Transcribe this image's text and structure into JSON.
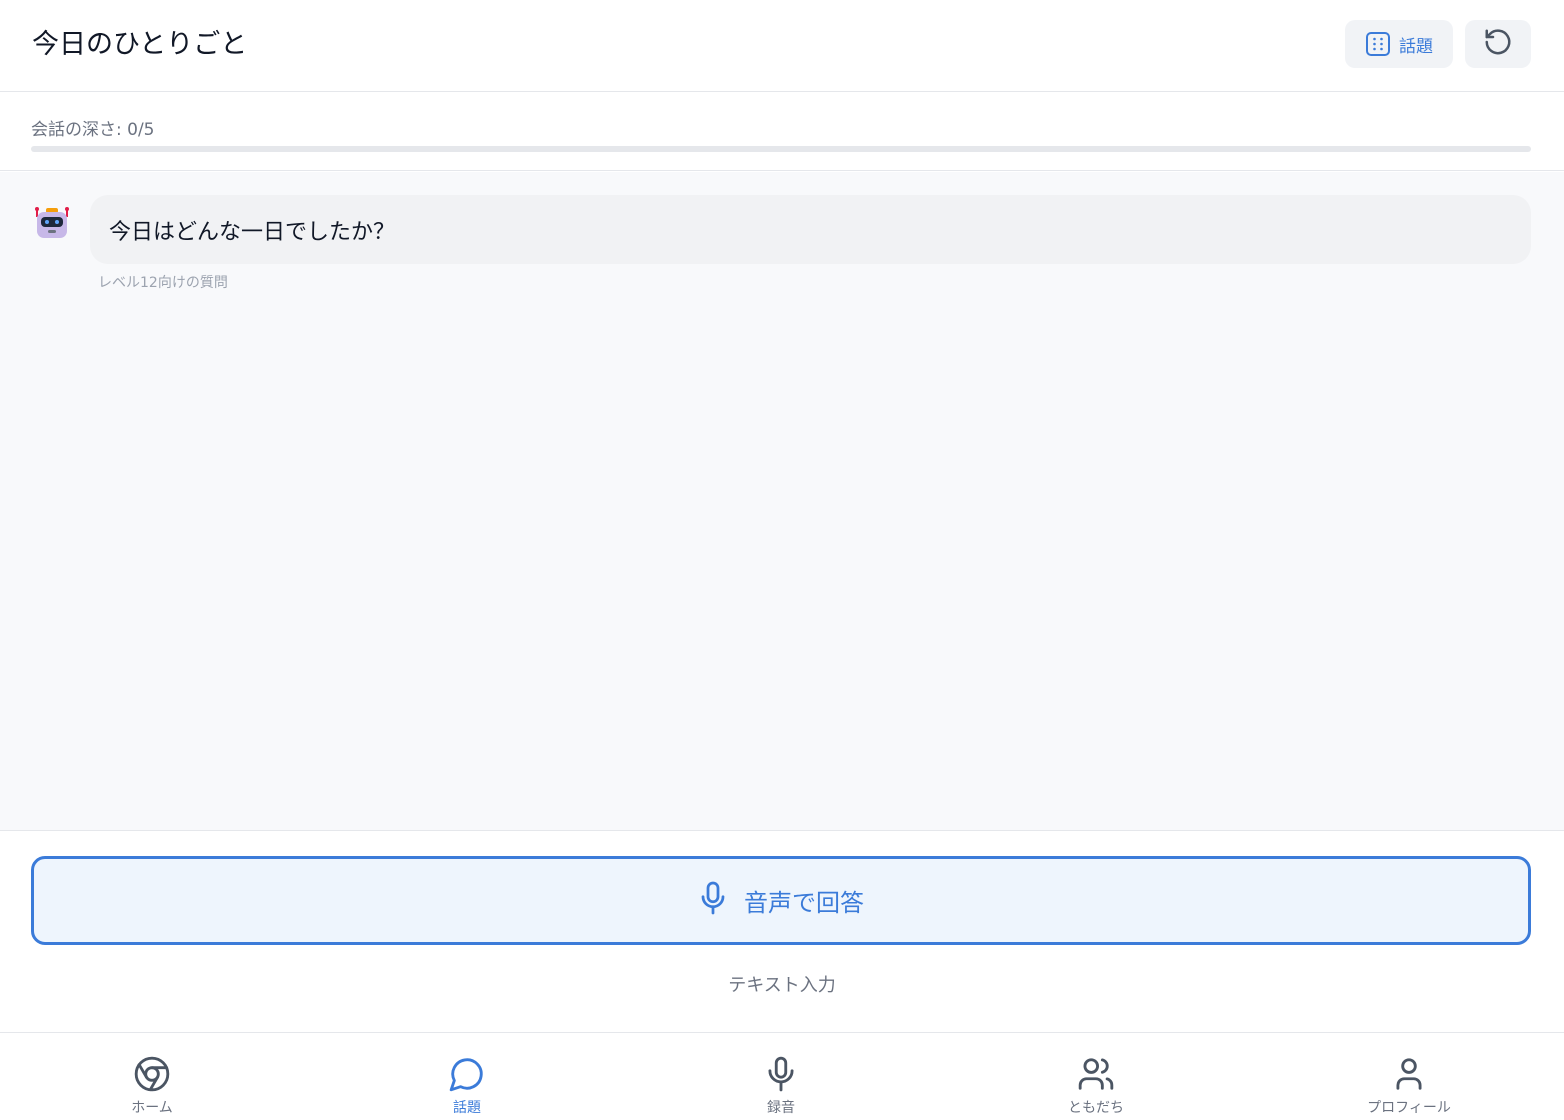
{
  "header": {
    "title": "今日のひとりごと",
    "topic_button_label": "話題",
    "topic_icon": "grid-dots-icon",
    "reset_icon": "rotate-ccw-icon"
  },
  "depth": {
    "label": "会話の深さ: 0/5",
    "current": 0,
    "max": 5
  },
  "chat": {
    "messages": [
      {
        "sender_icon": "robot-icon",
        "text": "今日はどんな一日でしたか？",
        "meta": "レベル12向けの質問"
      }
    ]
  },
  "input": {
    "voice_button_label": "音声で回答",
    "voice_icon": "microphone-icon",
    "text_input_label": "テキスト入力"
  },
  "nav": {
    "items": [
      {
        "icon": "chrome-icon",
        "label": "ホーム",
        "active": false
      },
      {
        "icon": "chat-bubble-icon",
        "label": "話題",
        "active": true
      },
      {
        "icon": "microphone-icon",
        "label": "録音",
        "active": false
      },
      {
        "icon": "users-icon",
        "label": "ともだち",
        "active": false
      },
      {
        "icon": "user-icon",
        "label": "プロフィール",
        "active": false
      }
    ]
  },
  "colors": {
    "accent": "#3b7bd9",
    "chat_background": "#f8f9fb",
    "bubble_background": "#f1f2f4",
    "voice_button_background": "#eef5fd"
  }
}
